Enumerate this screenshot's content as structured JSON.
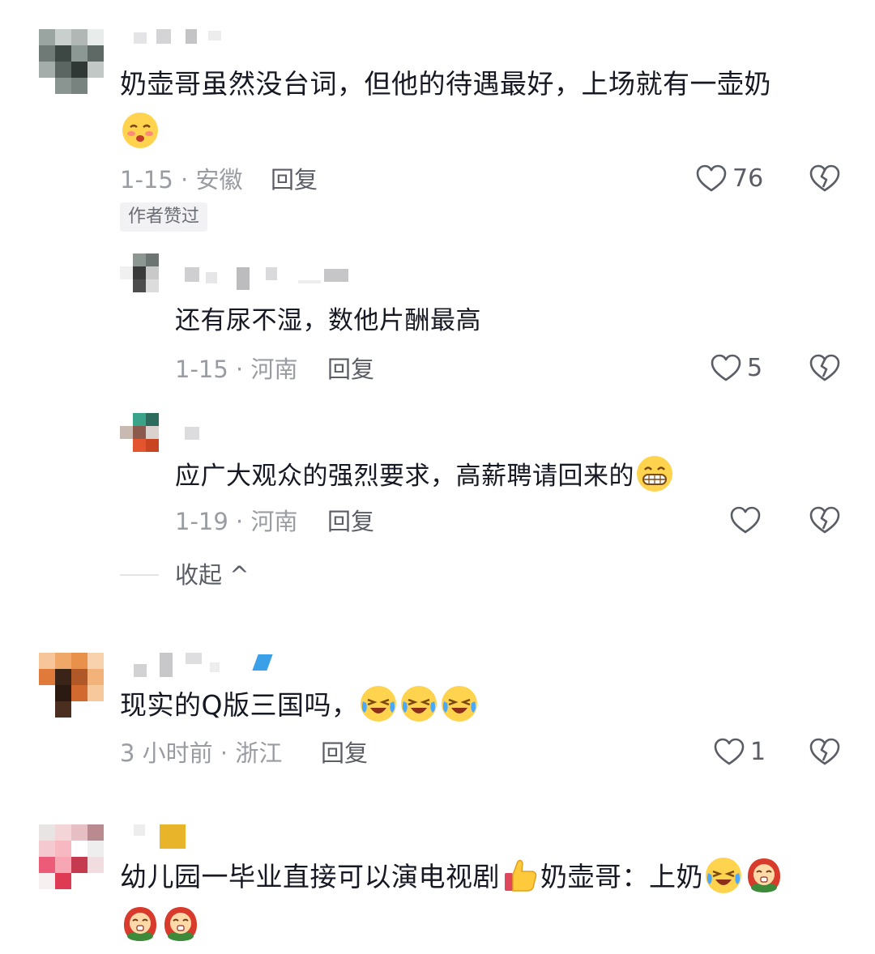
{
  "comments": [
    {
      "text": "奶壶哥虽然没台词，但他的待遇最好，上场就有一壶奶",
      "date_location": "1-15 · 安徽",
      "reply_label": "回复",
      "likes": "76",
      "badge": "作者赞过",
      "emojis": [
        "shy-emoji"
      ],
      "replies": [
        {
          "text": "还有尿不湿，数他片酬最高",
          "date_location": "1-15 · 河南",
          "reply_label": "回复",
          "likes": "5"
        },
        {
          "text": "应广大观众的强烈要求，高薪聘请回来的",
          "date_location": "1-19 · 河南",
          "reply_label": "回复",
          "likes": "",
          "emojis": [
            "grin-emoji"
          ]
        }
      ],
      "collapse_label": "收起 ^"
    },
    {
      "text": "现实的Q版三国吗，",
      "date_location": "3 小时前 · 浙江",
      "reply_label": "回复",
      "likes": "1",
      "emojis": [
        "laugh-cry-emoji",
        "laugh-cry-emoji",
        "laugh-cry-emoji"
      ]
    },
    {
      "text": "幼儿园一毕业直接可以演电视剧",
      "text_after_thumb": "奶壶哥：上奶",
      "emojis": [
        "thumbs-up-emoji",
        "laugh-cry-emoji",
        "baby-doll-emoji",
        "baby-doll-emoji",
        "baby-doll-emoji"
      ]
    }
  ],
  "colors": {
    "text": "#161823",
    "meta": "#9a9ca3",
    "icon": "#5b5d66"
  }
}
